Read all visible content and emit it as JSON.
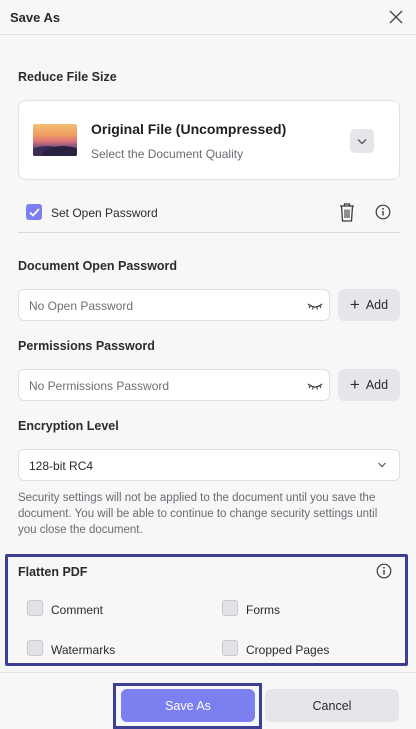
{
  "window": {
    "title": "Save As"
  },
  "reduce": {
    "heading": "Reduce File Size",
    "card_title": "Original File (Uncompressed)",
    "card_subtitle": "Select the Document Quality"
  },
  "password_toggle": {
    "label": "Set Open Password",
    "checked": true
  },
  "open_password": {
    "heading": "Document Open Password",
    "placeholder": "No Open Password",
    "add_label": "Add"
  },
  "permissions_password": {
    "heading": "Permissions Password",
    "placeholder": "No Permissions Password",
    "add_label": "Add"
  },
  "encryption": {
    "heading": "Encryption Level",
    "selected": "128-bit RC4"
  },
  "note": "Security settings will not be applied to the document until you save the document. You will be able to continue to change security settings until you close the document.",
  "flatten": {
    "heading": "Flatten PDF",
    "options": {
      "comment": "Comment",
      "forms": "Forms",
      "watermarks": "Watermarks",
      "cropped_pages": "Cropped Pages"
    }
  },
  "footer": {
    "save_label": "Save As",
    "cancel_label": "Cancel"
  },
  "colors": {
    "accent": "#7b7ff0",
    "highlight": "#3c3f93"
  }
}
